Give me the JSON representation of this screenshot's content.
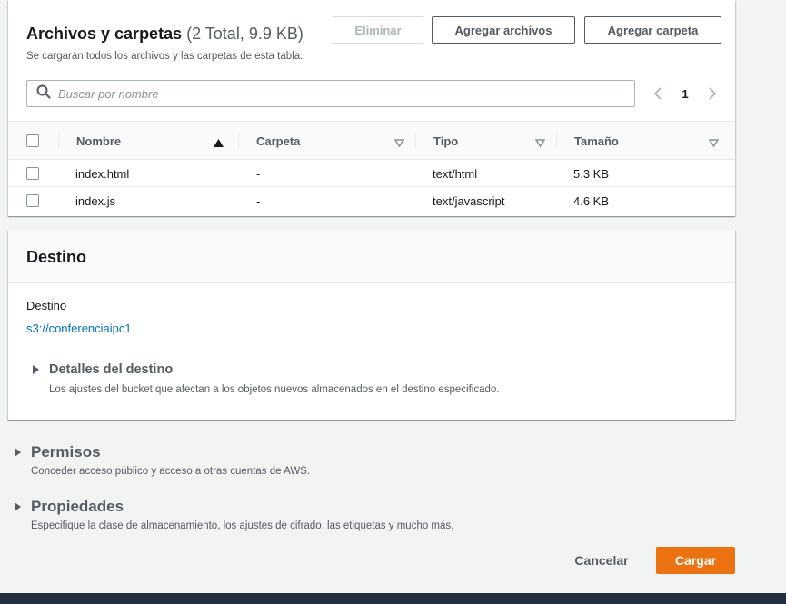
{
  "files_panel": {
    "title": "Archivos y carpetas",
    "count": "(2 Total, 9.9 KB)",
    "description": "Se cargarán todos los archivos y las carpetas de esta tabla.",
    "delete_label": "Eliminar",
    "add_files_label": "Agregar archivos",
    "add_folder_label": "Agregar carpeta",
    "search_placeholder": "Buscar por nombre",
    "page_number": "1",
    "columns": {
      "name": "Nombre",
      "folder": "Carpeta",
      "type": "Tipo",
      "size": "Tamaño"
    },
    "rows": [
      {
        "name": "index.html",
        "folder": "-",
        "type": "text/html",
        "size": "5.3 KB"
      },
      {
        "name": "index.js",
        "folder": "-",
        "type": "text/javascript",
        "size": "4.6 KB"
      }
    ]
  },
  "destination": {
    "heading": "Destino",
    "label": "Destino",
    "link": "s3://conferenciaipc1",
    "details_title": "Detalles del destino",
    "details_desc": "Los ajustes del bucket que afectan a los objetos nuevos almacenados en el destino especificado."
  },
  "permissions": {
    "title": "Permisos",
    "desc": "Conceder acceso público y acceso a otras cuentas de AWS."
  },
  "properties": {
    "title": "Propiedades",
    "desc": "Especifique la clase de almacenamiento, los ajustes de cifrado, las etiquetas y mucho más."
  },
  "actions": {
    "cancel_label": "Cancelar",
    "upload_label": "Cargar"
  },
  "colors": {
    "primary": "#ec7211",
    "link": "#0073bb",
    "footer": "#232f3e"
  },
  "icons": {
    "search": "search-icon",
    "sort_asc": "sort-ascending-icon",
    "sort": "sort-icon",
    "prev": "chevron-left-icon",
    "next": "chevron-right-icon",
    "expand": "caret-right-icon"
  }
}
